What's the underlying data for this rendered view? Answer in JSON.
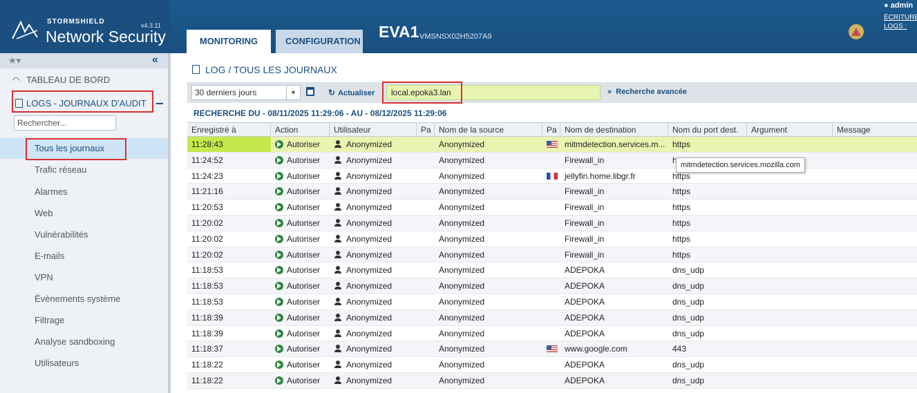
{
  "header": {
    "brand": "STORMSHIELD",
    "version": "v4.3.11",
    "product": "Network Security",
    "tabs": [
      {
        "label": "MONITORING",
        "active": true
      },
      {
        "label": "CONFIGURATION",
        "active": false
      }
    ],
    "firewall_name": "EVA1",
    "firewall_serial": "VMSNSX02H5207A9",
    "alert_icon": "warning-triangle-icon",
    "user": "admin",
    "links": [
      "ÉCRITURE",
      "LOGS :"
    ],
    "colors": {
      "header_bg": "#1b4f80",
      "accent": "#1b4f80"
    }
  },
  "sidebar": {
    "favorites_icon": "star-icon",
    "collapse_label": "«",
    "dashboard_label": "TABLEAU DE BORD",
    "logs_label": "LOGS - JOURNAUX D'AUDIT",
    "search_placeholder": "Rechercher...",
    "items": [
      {
        "label": "Tous les journaux",
        "active": true
      },
      {
        "label": "Trafic réseau"
      },
      {
        "label": "Alarmes"
      },
      {
        "label": "Web"
      },
      {
        "label": "Vulnérabilités"
      },
      {
        "label": "E-mails"
      },
      {
        "label": "VPN"
      },
      {
        "label": "Évènements système"
      },
      {
        "label": "Filtrage"
      },
      {
        "label": "Analyse sandboxing"
      },
      {
        "label": "Utilisateurs"
      }
    ]
  },
  "main": {
    "title": "LOG / TOUS LES JOURNAUX",
    "period": "30 derniers jours",
    "refresh_label": "Actualiser",
    "filter_value": "local.epoka3.lan",
    "advanced_label": "Recherche avancée",
    "range": "RECHERCHE DU - 08/11/2025 11:29:06 - AU - 08/12/2025 11:29:06",
    "tooltip": "mitmdetection.services.mozilla.com",
    "columns": [
      "Enregistré à",
      "Action",
      "Utilisateur",
      "Pa",
      "Nom de la source",
      "Pa",
      "Nom de destination",
      "Nom du port dest.",
      "Argument",
      "Message"
    ],
    "rows": [
      {
        "time": "11:28:43",
        "action": "Autoriser",
        "user": "Anonymized",
        "src": "Anonymized",
        "flag": "us",
        "dst": "mitmdetection.services.m...",
        "port": "https"
      },
      {
        "time": "11:24:52",
        "action": "Autoriser",
        "user": "Anonymized",
        "src": "Anonymized",
        "flag": "",
        "dst": "Firewall_in",
        "port": "https"
      },
      {
        "time": "11:24:23",
        "action": "Autoriser",
        "user": "Anonymized",
        "src": "Anonymized",
        "flag": "fr",
        "dst": "jellyfin.home.libgr.fr",
        "port": "https"
      },
      {
        "time": "11:21:16",
        "action": "Autoriser",
        "user": "Anonymized",
        "src": "Anonymized",
        "flag": "",
        "dst": "Firewall_in",
        "port": "https"
      },
      {
        "time": "11:20:53",
        "action": "Autoriser",
        "user": "Anonymized",
        "src": "Anonymized",
        "flag": "",
        "dst": "Firewall_in",
        "port": "https"
      },
      {
        "time": "11:20:02",
        "action": "Autoriser",
        "user": "Anonymized",
        "src": "Anonymized",
        "flag": "",
        "dst": "Firewall_in",
        "port": "https"
      },
      {
        "time": "11:20:02",
        "action": "Autoriser",
        "user": "Anonymized",
        "src": "Anonymized",
        "flag": "",
        "dst": "Firewall_in",
        "port": "https"
      },
      {
        "time": "11:20:02",
        "action": "Autoriser",
        "user": "Anonymized",
        "src": "Anonymized",
        "flag": "",
        "dst": "Firewall_in",
        "port": "https"
      },
      {
        "time": "11:18:53",
        "action": "Autoriser",
        "user": "Anonymized",
        "src": "Anonymized",
        "flag": "",
        "dst": "ADEPOKA",
        "port": "dns_udp"
      },
      {
        "time": "11:18:53",
        "action": "Autoriser",
        "user": "Anonymized",
        "src": "Anonymized",
        "flag": "",
        "dst": "ADEPOKA",
        "port": "dns_udp"
      },
      {
        "time": "11:18:53",
        "action": "Autoriser",
        "user": "Anonymized",
        "src": "Anonymized",
        "flag": "",
        "dst": "ADEPOKA",
        "port": "dns_udp"
      },
      {
        "time": "11:18:39",
        "action": "Autoriser",
        "user": "Anonymized",
        "src": "Anonymized",
        "flag": "",
        "dst": "ADEPOKA",
        "port": "dns_udp"
      },
      {
        "time": "11:18:39",
        "action": "Autoriser",
        "user": "Anonymized",
        "src": "Anonymized",
        "flag": "",
        "dst": "ADEPOKA",
        "port": "dns_udp"
      },
      {
        "time": "11:18:37",
        "action": "Autoriser",
        "user": "Anonymized",
        "src": "Anonymized",
        "flag": "us",
        "dst": "www.google.com",
        "port": "443"
      },
      {
        "time": "11:18:22",
        "action": "Autoriser",
        "user": "Anonymized",
        "src": "Anonymized",
        "flag": "",
        "dst": "ADEPOKA",
        "port": "dns_udp"
      },
      {
        "time": "11:18:22",
        "action": "Autoriser",
        "user": "Anonymized",
        "src": "Anonymized",
        "flag": "",
        "dst": "ADEPOKA",
        "port": "dns_udp"
      }
    ]
  }
}
